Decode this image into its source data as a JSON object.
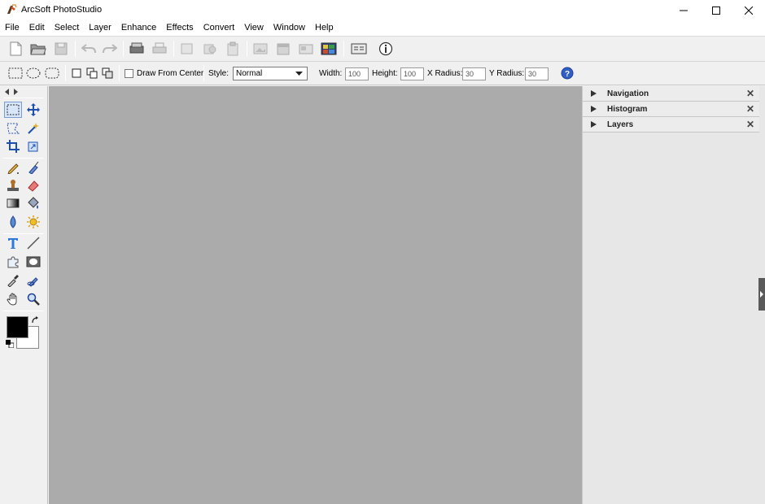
{
  "window": {
    "title": "ArcSoft PhotoStudio",
    "controls": {
      "minimize": "—",
      "maximize": "☐",
      "close": "✕"
    }
  },
  "menu": [
    "File",
    "Edit",
    "Select",
    "Layer",
    "Enhance",
    "Effects",
    "Convert",
    "View",
    "Window",
    "Help"
  ],
  "toolbar": {
    "icons": [
      "new-icon",
      "open-icon",
      "save-icon",
      "undo-icon",
      "redo-icon",
      "scan-icon",
      "print-icon",
      "copy-icon",
      "paste-icon",
      "clipboard-icon",
      "image-icon",
      "calendar-icon",
      "card-icon",
      "slideshow-icon",
      "panel-toggle-icon",
      "info-icon"
    ]
  },
  "options": {
    "draw_from_center": "Draw From Center",
    "style_label": "Style:",
    "style_value": "Normal",
    "width_label": "Width:",
    "width_value": "100",
    "height_label": "Height:",
    "height_value": "100",
    "xradius_label": "X Radius:",
    "xradius_value": "30",
    "yradius_label": "Y Radius:",
    "yradius_value": "30"
  },
  "panels": [
    {
      "name": "Navigation",
      "close": "✕"
    },
    {
      "name": "Histogram",
      "close": "✕"
    },
    {
      "name": "Layers",
      "close": "✕"
    }
  ],
  "colors": {
    "canvas": "#ababab",
    "foreground": "#000000",
    "background": "#ffffff",
    "accent": "#2f5fc6"
  }
}
